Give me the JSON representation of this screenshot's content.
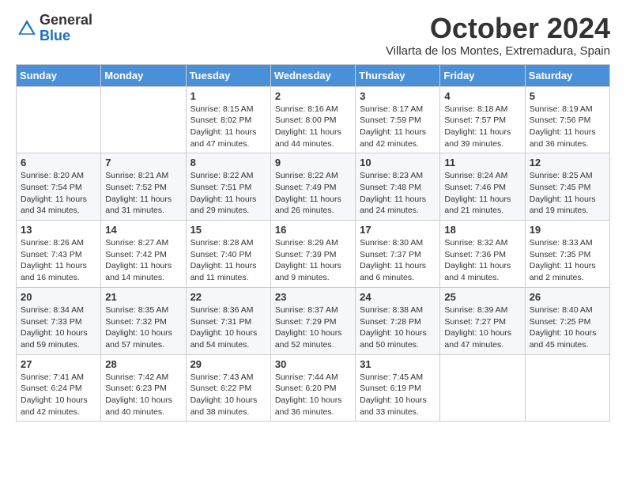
{
  "header": {
    "logo_general": "General",
    "logo_blue": "Blue",
    "month_title": "October 2024",
    "subtitle": "Villarta de los Montes, Extremadura, Spain"
  },
  "days_of_week": [
    "Sunday",
    "Monday",
    "Tuesday",
    "Wednesday",
    "Thursday",
    "Friday",
    "Saturday"
  ],
  "weeks": [
    [
      {
        "day": "",
        "info": ""
      },
      {
        "day": "",
        "info": ""
      },
      {
        "day": "1",
        "info": "Sunrise: 8:15 AM\nSunset: 8:02 PM\nDaylight: 11 hours and 47 minutes."
      },
      {
        "day": "2",
        "info": "Sunrise: 8:16 AM\nSunset: 8:00 PM\nDaylight: 11 hours and 44 minutes."
      },
      {
        "day": "3",
        "info": "Sunrise: 8:17 AM\nSunset: 7:59 PM\nDaylight: 11 hours and 42 minutes."
      },
      {
        "day": "4",
        "info": "Sunrise: 8:18 AM\nSunset: 7:57 PM\nDaylight: 11 hours and 39 minutes."
      },
      {
        "day": "5",
        "info": "Sunrise: 8:19 AM\nSunset: 7:56 PM\nDaylight: 11 hours and 36 minutes."
      }
    ],
    [
      {
        "day": "6",
        "info": "Sunrise: 8:20 AM\nSunset: 7:54 PM\nDaylight: 11 hours and 34 minutes."
      },
      {
        "day": "7",
        "info": "Sunrise: 8:21 AM\nSunset: 7:52 PM\nDaylight: 11 hours and 31 minutes."
      },
      {
        "day": "8",
        "info": "Sunrise: 8:22 AM\nSunset: 7:51 PM\nDaylight: 11 hours and 29 minutes."
      },
      {
        "day": "9",
        "info": "Sunrise: 8:22 AM\nSunset: 7:49 PM\nDaylight: 11 hours and 26 minutes."
      },
      {
        "day": "10",
        "info": "Sunrise: 8:23 AM\nSunset: 7:48 PM\nDaylight: 11 hours and 24 minutes."
      },
      {
        "day": "11",
        "info": "Sunrise: 8:24 AM\nSunset: 7:46 PM\nDaylight: 11 hours and 21 minutes."
      },
      {
        "day": "12",
        "info": "Sunrise: 8:25 AM\nSunset: 7:45 PM\nDaylight: 11 hours and 19 minutes."
      }
    ],
    [
      {
        "day": "13",
        "info": "Sunrise: 8:26 AM\nSunset: 7:43 PM\nDaylight: 11 hours and 16 minutes."
      },
      {
        "day": "14",
        "info": "Sunrise: 8:27 AM\nSunset: 7:42 PM\nDaylight: 11 hours and 14 minutes."
      },
      {
        "day": "15",
        "info": "Sunrise: 8:28 AM\nSunset: 7:40 PM\nDaylight: 11 hours and 11 minutes."
      },
      {
        "day": "16",
        "info": "Sunrise: 8:29 AM\nSunset: 7:39 PM\nDaylight: 11 hours and 9 minutes."
      },
      {
        "day": "17",
        "info": "Sunrise: 8:30 AM\nSunset: 7:37 PM\nDaylight: 11 hours and 6 minutes."
      },
      {
        "day": "18",
        "info": "Sunrise: 8:32 AM\nSunset: 7:36 PM\nDaylight: 11 hours and 4 minutes."
      },
      {
        "day": "19",
        "info": "Sunrise: 8:33 AM\nSunset: 7:35 PM\nDaylight: 11 hours and 2 minutes."
      }
    ],
    [
      {
        "day": "20",
        "info": "Sunrise: 8:34 AM\nSunset: 7:33 PM\nDaylight: 10 hours and 59 minutes."
      },
      {
        "day": "21",
        "info": "Sunrise: 8:35 AM\nSunset: 7:32 PM\nDaylight: 10 hours and 57 minutes."
      },
      {
        "day": "22",
        "info": "Sunrise: 8:36 AM\nSunset: 7:31 PM\nDaylight: 10 hours and 54 minutes."
      },
      {
        "day": "23",
        "info": "Sunrise: 8:37 AM\nSunset: 7:29 PM\nDaylight: 10 hours and 52 minutes."
      },
      {
        "day": "24",
        "info": "Sunrise: 8:38 AM\nSunset: 7:28 PM\nDaylight: 10 hours and 50 minutes."
      },
      {
        "day": "25",
        "info": "Sunrise: 8:39 AM\nSunset: 7:27 PM\nDaylight: 10 hours and 47 minutes."
      },
      {
        "day": "26",
        "info": "Sunrise: 8:40 AM\nSunset: 7:25 PM\nDaylight: 10 hours and 45 minutes."
      }
    ],
    [
      {
        "day": "27",
        "info": "Sunrise: 7:41 AM\nSunset: 6:24 PM\nDaylight: 10 hours and 42 minutes."
      },
      {
        "day": "28",
        "info": "Sunrise: 7:42 AM\nSunset: 6:23 PM\nDaylight: 10 hours and 40 minutes."
      },
      {
        "day": "29",
        "info": "Sunrise: 7:43 AM\nSunset: 6:22 PM\nDaylight: 10 hours and 38 minutes."
      },
      {
        "day": "30",
        "info": "Sunrise: 7:44 AM\nSunset: 6:20 PM\nDaylight: 10 hours and 36 minutes."
      },
      {
        "day": "31",
        "info": "Sunrise: 7:45 AM\nSunset: 6:19 PM\nDaylight: 10 hours and 33 minutes."
      },
      {
        "day": "",
        "info": ""
      },
      {
        "day": "",
        "info": ""
      }
    ]
  ]
}
